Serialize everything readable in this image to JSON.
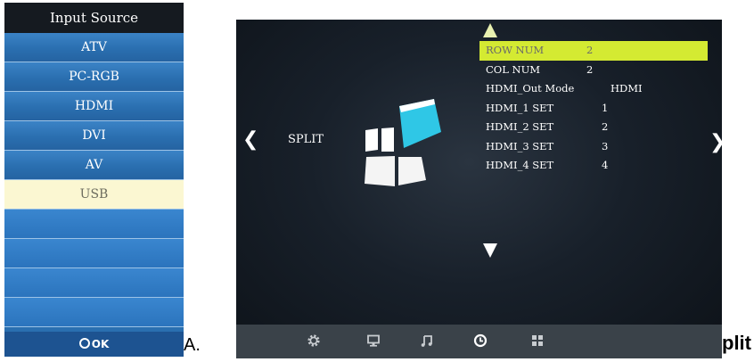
{
  "input_source": {
    "title": "Input Source",
    "items": [
      {
        "label": "ATV"
      },
      {
        "label": "PC-RGB"
      },
      {
        "label": "HDMI"
      },
      {
        "label": "DVI"
      },
      {
        "label": "AV"
      },
      {
        "label": "USB",
        "selected": true
      }
    ],
    "footer": "OK",
    "colors": {
      "panel": "#2a6fb0",
      "selected": "#fbf7d2",
      "title_bar": "#151a20"
    }
  },
  "captions": {
    "left": "A.",
    "right": "plit"
  },
  "tv_menu": {
    "section_label": "SPLIT",
    "nav_left": "❮",
    "nav_right": "❯",
    "items": [
      {
        "label": "ROW NUM",
        "value": "2",
        "selected": true
      },
      {
        "label": "COL NUM",
        "value": "2"
      },
      {
        "label": "HDMI_Out Mode",
        "value": "HDMI"
      },
      {
        "label": "HDMI_1 SET",
        "value": "1"
      },
      {
        "label": "HDMI_2 SET",
        "value": "2"
      },
      {
        "label": "HDMI_3 SET",
        "value": "3"
      },
      {
        "label": "HDMI_4 SET",
        "value": "4"
      }
    ],
    "bottom_icons": [
      "gear-icon",
      "monitor-icon",
      "music-note-icon",
      "clock-icon",
      "grid-icon"
    ],
    "colors": {
      "highlight": "#d4ea32",
      "bottom_bar": "#3a4249",
      "logo_accent": "#2fc7e6"
    }
  }
}
